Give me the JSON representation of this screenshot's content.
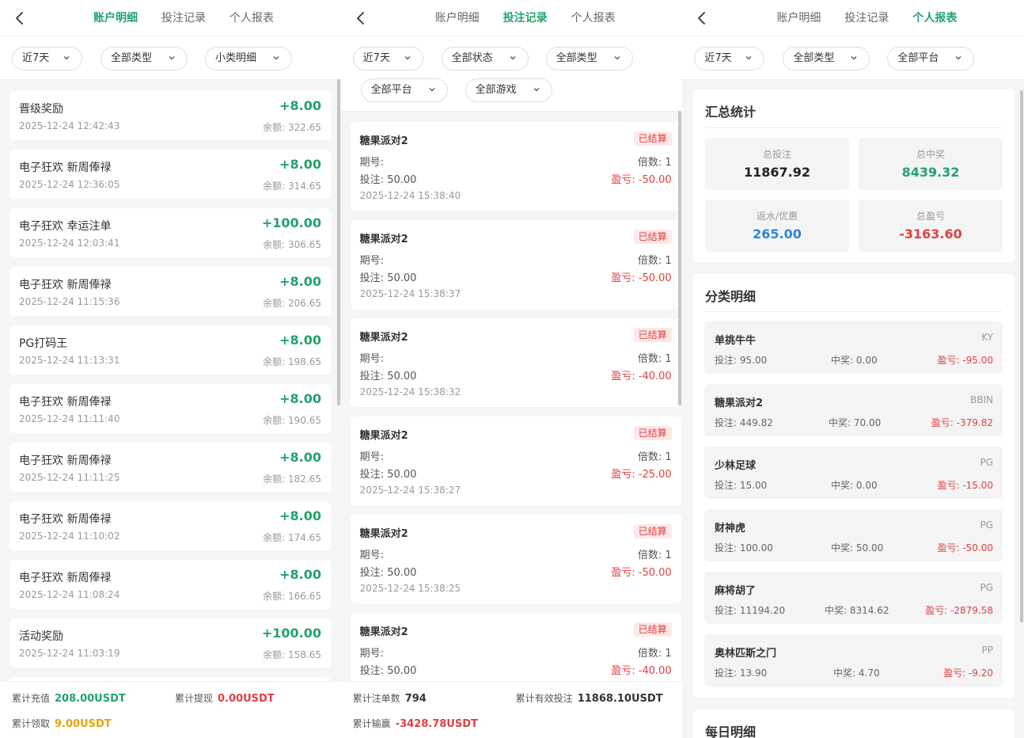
{
  "tabs": [
    "账户明细",
    "投注记录",
    "个人报表"
  ],
  "panel1": {
    "active_tab": 0,
    "filters": [
      "近7天",
      "全部类型",
      "小类明细"
    ],
    "balance_prefix": "余额:",
    "items": [
      {
        "title": "晋级奖励",
        "time": "2025-12-24 12:42:43",
        "amount": "+8.00",
        "balance": "322.65"
      },
      {
        "title": "电子狂欢 新周俸禄",
        "time": "2025-12-24 12:36:05",
        "amount": "+8.00",
        "balance": "314.65"
      },
      {
        "title": "电子狂欢 幸运注单",
        "time": "2025-12-24 12:03:41",
        "amount": "+100.00",
        "balance": "306.65"
      },
      {
        "title": "电子狂欢 新周俸禄",
        "time": "2025-12-24 11:15:36",
        "amount": "+8.00",
        "balance": "206.65"
      },
      {
        "title": "PG打码王",
        "time": "2025-12-24 11:13:31",
        "amount": "+8.00",
        "balance": "198.65"
      },
      {
        "title": "电子狂欢 新周俸禄",
        "time": "2025-12-24 11:11:40",
        "amount": "+8.00",
        "balance": "190.65"
      },
      {
        "title": "电子狂欢 新周俸禄",
        "time": "2025-12-24 11:11:25",
        "amount": "+8.00",
        "balance": "182.65"
      },
      {
        "title": "电子狂欢 新周俸禄",
        "time": "2025-12-24 11:10:02",
        "amount": "+8.00",
        "balance": "174.65"
      },
      {
        "title": "电子狂欢 新周俸禄",
        "time": "2025-12-24 11:08:24",
        "amount": "+8.00",
        "balance": "166.65"
      },
      {
        "title": "活动奖励",
        "time": "2025-12-24 11:03:19",
        "amount": "+100.00",
        "balance": "158.65"
      }
    ],
    "footer": {
      "recharge_label": "累计充值",
      "recharge_value": "208.00USDT",
      "withdraw_label": "累计提现",
      "withdraw_value": "0.00USDT",
      "claim_label": "累计领取",
      "claim_value": "9.00USDT"
    }
  },
  "panel2": {
    "active_tab": 1,
    "filters": [
      "近7天",
      "全部状态",
      "全部类型",
      "全部平台",
      "全部游戏"
    ],
    "labels": {
      "period": "期号:",
      "multiple": "倍数:",
      "bet": "投注:",
      "pnl": "盈亏:"
    },
    "bets": [
      {
        "game": "糖果派对2",
        "status": "已结算",
        "multiple": "1",
        "bet": "50.00",
        "pnl": "-50.00",
        "time": "2025-12-24 15:38:40"
      },
      {
        "game": "糖果派对2",
        "status": "已结算",
        "multiple": "1",
        "bet": "50.00",
        "pnl": "-50.00",
        "time": "2025-12-24 15:38:37"
      },
      {
        "game": "糖果派对2",
        "status": "已结算",
        "multiple": "1",
        "bet": "50.00",
        "pnl": "-40.00",
        "time": "2025-12-24 15:38:32"
      },
      {
        "game": "糖果派对2",
        "status": "已结算",
        "multiple": "1",
        "bet": "50.00",
        "pnl": "-25.00",
        "time": "2025-12-24 15:38:27"
      },
      {
        "game": "糖果派对2",
        "status": "已结算",
        "multiple": "1",
        "bet": "50.00",
        "pnl": "-50.00",
        "time": "2025-12-24 15:38:25"
      },
      {
        "game": "糖果派对2",
        "status": "已结算",
        "multiple": "1",
        "bet": "50.00",
        "pnl": "-40.00",
        "time": ""
      }
    ],
    "footer": {
      "count_label": "累计注单数",
      "count_value": "794",
      "valid_label": "累计有效投注",
      "valid_value": "11868.10USDT",
      "winloss_label": "累计输赢",
      "winloss_value": "-3428.78USDT"
    }
  },
  "panel3": {
    "active_tab": 2,
    "filters": [
      "近7天",
      "全部类型",
      "全部平台"
    ],
    "summary_title": "汇总统计",
    "stats": [
      {
        "label": "总投注",
        "value": "11867.92",
        "color": "#222222"
      },
      {
        "label": "总中奖",
        "value": "8439.32",
        "color": "#23a26d"
      },
      {
        "label": "返水/优惠",
        "value": "265.00",
        "color": "#2f86d6"
      },
      {
        "label": "总盈亏",
        "value": "-3163.60",
        "color": "#e04040"
      }
    ],
    "category_title": "分类明细",
    "cat_labels": {
      "bet": "投注:",
      "win": "中奖:",
      "pnl": "盈亏:"
    },
    "categories": [
      {
        "name": "单挑牛牛",
        "platform": "KY",
        "bet": "95.00",
        "win": "0.00",
        "pnl": "-95.00"
      },
      {
        "name": "糖果派对2",
        "platform": "BBIN",
        "bet": "449.82",
        "win": "70.00",
        "pnl": "-379.82"
      },
      {
        "name": "少林足球",
        "platform": "PG",
        "bet": "15.00",
        "win": "0.00",
        "pnl": "-15.00"
      },
      {
        "name": "财神虎",
        "platform": "PG",
        "bet": "100.00",
        "win": "50.00",
        "pnl": "-50.00"
      },
      {
        "name": "麻将胡了",
        "platform": "PG",
        "bet": "11194.20",
        "win": "8314.62",
        "pnl": "-2879.58"
      },
      {
        "name": "奥林匹斯之门",
        "platform": "PP",
        "bet": "13.90",
        "win": "4.70",
        "pnl": "-9.20"
      }
    ],
    "daily_title": "每日明细"
  }
}
